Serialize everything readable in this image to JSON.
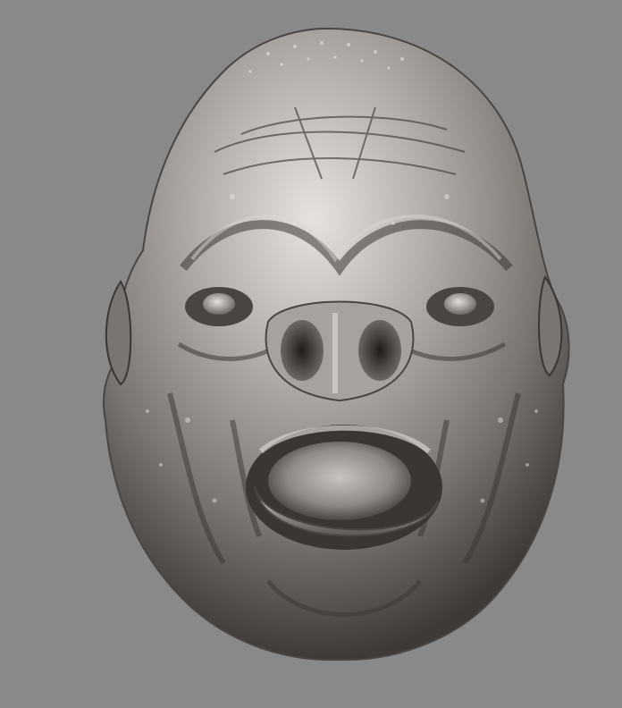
{
  "viewport": {
    "background_color": "#898989",
    "subject": "sculpted-head-render"
  },
  "material": {
    "base_color": "#8e8985",
    "highlight_color": "#e9e6e3",
    "shadow_color": "#2d2a28"
  }
}
